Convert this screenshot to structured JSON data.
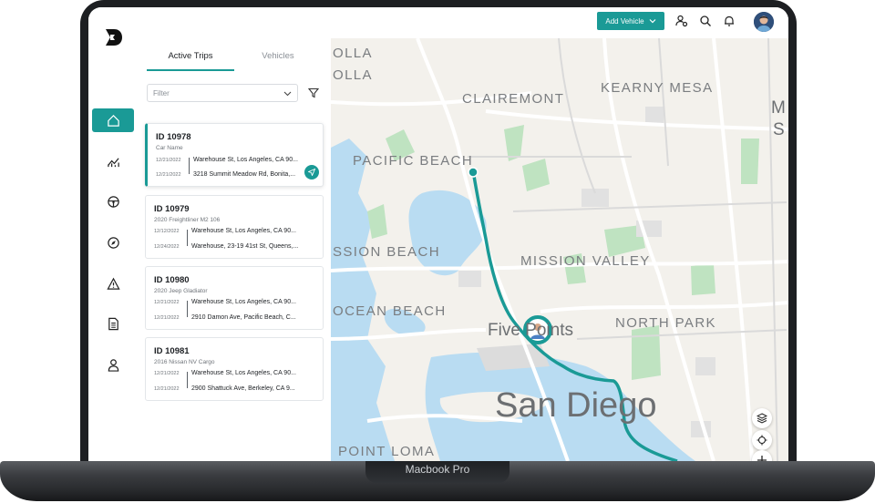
{
  "device": {
    "label": "Macbook Pro"
  },
  "topbar": {
    "add_vehicle_label": "Add Vehicle"
  },
  "tabs": {
    "active": "Active Trips",
    "inactive": "Vehicles"
  },
  "filter": {
    "placeholder": "Filter"
  },
  "trips": [
    {
      "id": "ID 10978",
      "vehicle": "Car Name",
      "rows": [
        {
          "date": "12/21/2022",
          "address": "Warehouse St, Los Angeles, CA 90..."
        },
        {
          "date": "12/21/2022",
          "address": "3218 Summit Meadow Rd, Bonita,..."
        }
      ]
    },
    {
      "id": "ID 10979",
      "vehicle": "2020 Freightliner M2 106",
      "rows": [
        {
          "date": "12/12/2022",
          "address": "Warehouse St, Los Angeles, CA 90..."
        },
        {
          "date": "12/24/2022",
          "address": "Warehouse, 23-19 41st St, Queens,..."
        }
      ]
    },
    {
      "id": "ID 10980",
      "vehicle": "2020 Jeep Gladiator",
      "rows": [
        {
          "date": "12/21/2022",
          "address": "Warehouse St, Los Angeles, CA 90..."
        },
        {
          "date": "12/21/2022",
          "address": "2910 Damon Ave, Pacific Beach, C..."
        }
      ]
    },
    {
      "id": "ID 10981",
      "vehicle": "2016 Nissan NV Cargo",
      "rows": [
        {
          "date": "12/21/2022",
          "address": "Warehouse St, Los Angeles, CA 90..."
        },
        {
          "date": "12/21/2022",
          "address": "2900 Shattuck Ave, Berkeley, CA 9..."
        }
      ]
    }
  ],
  "map": {
    "labels": {
      "olla1": "OLLA",
      "olla2": "OLLA",
      "clairemont": "CLAIREMONT",
      "kearny_mesa": "KEARNY MESA",
      "m_edge": "M",
      "s_edge": "S",
      "pacific_beach": "PACIFIC BEACH",
      "mission_beach": "SSION BEACH",
      "mission_valley": "MISSION VALLEY",
      "ocean_beach": "OCEAN BEACH",
      "north_park": "NORTH PARK",
      "five_points": "Five Points",
      "san_diego": "San Diego",
      "point_loma": "POINT LOMA"
    }
  },
  "colors": {
    "accent": "#1a9a96",
    "water": "#b9dcf2",
    "park": "#bfe3c1",
    "road": "#ffffff"
  },
  "icons": {
    "rail": [
      "home-icon",
      "analytics-icon",
      "steering-wheel-icon",
      "compass-icon",
      "warning-icon",
      "document-icon",
      "user-icon"
    ],
    "topbar": [
      "user-settings-icon",
      "search-icon",
      "bell-icon"
    ],
    "map": [
      "layers-icon",
      "locate-icon",
      "zoom-in-icon"
    ]
  }
}
